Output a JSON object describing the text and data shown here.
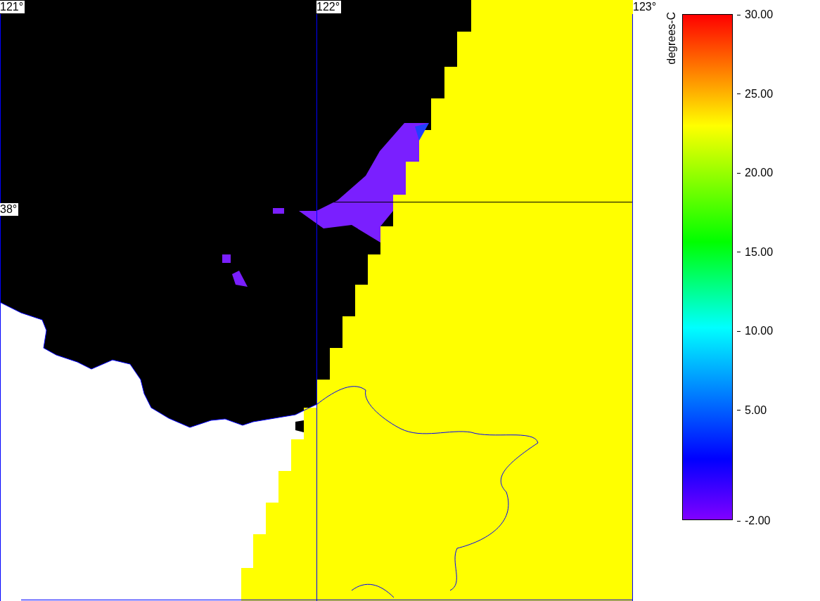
{
  "map": {
    "longitude_labels": [
      "121°",
      "122°",
      "123°"
    ],
    "latitude_labels": [
      "38°"
    ]
  },
  "legend": {
    "title": "degrees-C",
    "ticks": [
      "30.00",
      "25.00",
      "20.00",
      "15.00",
      "10.00",
      "5.00",
      "-2.00"
    ]
  }
}
